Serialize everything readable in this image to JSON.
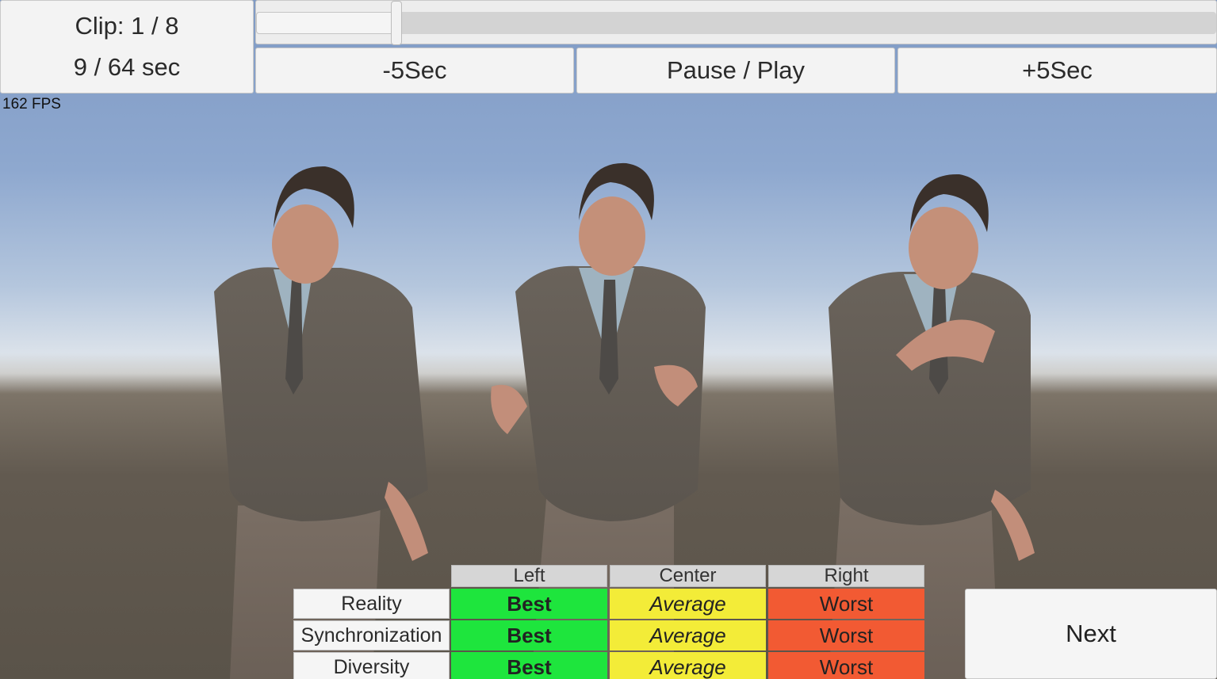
{
  "clip": {
    "clip_label": "Clip: 1 / 8",
    "time_label": "9 / 64 sec"
  },
  "timeline": {
    "progress": 0.14
  },
  "controls": {
    "back": "-5Sec",
    "pause_play": "Pause / Play",
    "forward": "+5Sec"
  },
  "fps": "162 FPS",
  "rating": {
    "columns": [
      "Left",
      "Center",
      "Right"
    ],
    "rows": [
      {
        "label": "Reality",
        "cells": [
          "Best",
          "Average",
          "Worst"
        ]
      },
      {
        "label": "Synchronization",
        "cells": [
          "Best",
          "Average",
          "Worst"
        ]
      },
      {
        "label": "Diversity",
        "cells": [
          "Best",
          "Average",
          "Worst"
        ]
      }
    ]
  },
  "next": "Next",
  "colors": {
    "best": "#1ee53d",
    "average": "#f3ec38",
    "worst": "#f25a33"
  }
}
